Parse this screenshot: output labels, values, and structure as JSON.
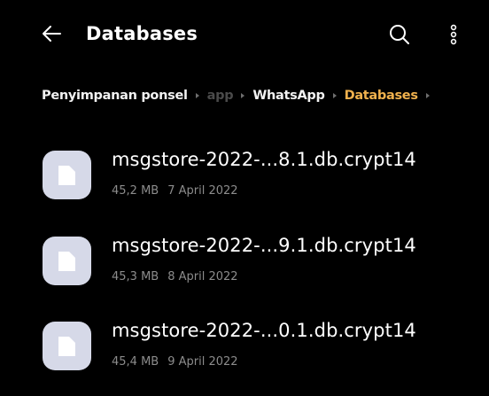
{
  "header": {
    "title": "Databases",
    "back_icon": "arrow-left-icon",
    "search_icon": "search-icon",
    "more_icon": "more-vertical-icon"
  },
  "breadcrumb": [
    {
      "label": "Penyimpanan ponsel",
      "state": "normal"
    },
    {
      "label": "app",
      "state": "faded"
    },
    {
      "label": "WhatsApp",
      "state": "normal"
    },
    {
      "label": "Databases",
      "state": "active"
    }
  ],
  "files": [
    {
      "name": "msgstore-2022-...8.1.db.crypt14",
      "size": "45,2 MB",
      "date": "7 April 2022"
    },
    {
      "name": "msgstore-2022-...9.1.db.crypt14",
      "size": "45,3 MB",
      "date": "8 April 2022"
    },
    {
      "name": "msgstore-2022-...0.1.db.crypt14",
      "size": "45,4 MB",
      "date": "9 April 2022"
    }
  ],
  "colors": {
    "background": "#000000",
    "accent": "#f0b14d",
    "file_icon_bg": "#d6d9e8",
    "meta_text": "#8c8c8c"
  }
}
